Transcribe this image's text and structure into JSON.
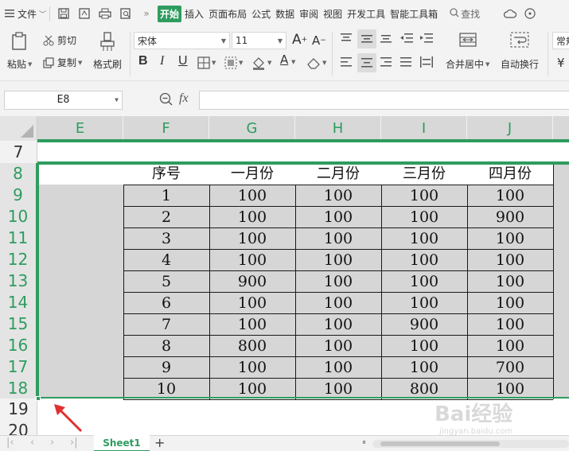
{
  "menubar": {
    "file_label": "文件",
    "tabs": [
      "开始",
      "插入",
      "页面布局",
      "公式",
      "数据",
      "审阅",
      "视图",
      "开发工具",
      "智能工具箱"
    ],
    "active_tab": "开始",
    "search_label": "查找"
  },
  "ribbon": {
    "paste_label": "粘贴",
    "cut_label": "剪切",
    "copy_label": "复制",
    "format_painter_label": "格式刷",
    "font_name": "宋体",
    "font_size": "11",
    "bold_label": "B",
    "italic_label": "I",
    "underline_label": "U",
    "font_color_label": "A",
    "merge_center_label": "合并居中",
    "wrap_text_label": "自动换行",
    "number_format_label": "常规",
    "currency_label": "¥"
  },
  "formula_bar": {
    "name_box": "E8",
    "fx_label": "fx",
    "formula_value": ""
  },
  "sheet": {
    "columns": [
      "E",
      "F",
      "G",
      "H",
      "I",
      "J"
    ],
    "rows_before": [
      "7"
    ],
    "header_row_number": "8",
    "data_row_numbers": [
      "9",
      "10",
      "11",
      "12",
      "13",
      "14",
      "15",
      "16",
      "17",
      "18"
    ],
    "rows_after": [
      "19",
      "20"
    ],
    "table_header": [
      "序号",
      "一月份",
      "二月份",
      "三月份",
      "四月份"
    ],
    "table_rows": [
      [
        "1",
        "100",
        "100",
        "100",
        "100"
      ],
      [
        "2",
        "100",
        "100",
        "100",
        "900"
      ],
      [
        "3",
        "100",
        "100",
        "100",
        "100"
      ],
      [
        "4",
        "100",
        "100",
        "100",
        "100"
      ],
      [
        "5",
        "900",
        "100",
        "100",
        "100"
      ],
      [
        "6",
        "100",
        "100",
        "100",
        "100"
      ],
      [
        "7",
        "100",
        "100",
        "900",
        "100"
      ],
      [
        "8",
        "800",
        "100",
        "100",
        "100"
      ],
      [
        "9",
        "100",
        "100",
        "100",
        "700"
      ],
      [
        "10",
        "100",
        "100",
        "800",
        "100"
      ]
    ]
  },
  "sheet_tabs": {
    "active": "Sheet1",
    "add_label": "+"
  },
  "watermark": {
    "brand": "Bai经验",
    "url": "jingyan.baidu.com"
  },
  "colors": {
    "accent": "#2e9c5f",
    "selection": "#d6d6d6"
  }
}
